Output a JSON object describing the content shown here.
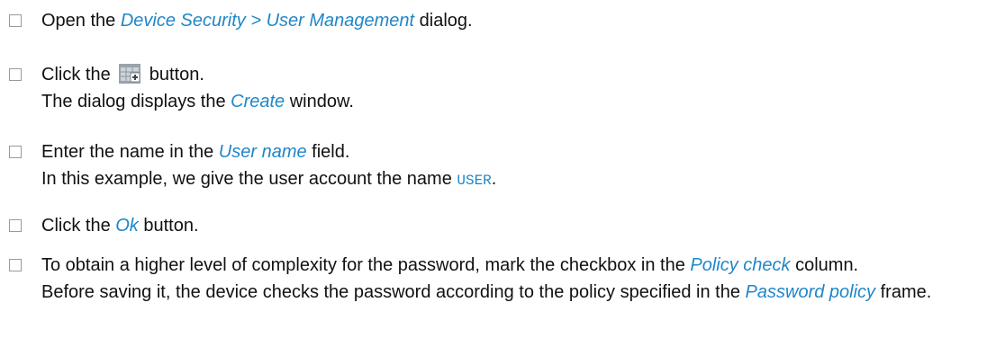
{
  "steps": [
    {
      "pre": "Open the ",
      "ref": "Device Security > User Management",
      "post": " dialog."
    },
    {
      "pre": "Click the ",
      "icon": "add-table-row-icon",
      "post": " button.",
      "result_pre": "The dialog displays the ",
      "result_ref": "Create",
      "result_post": " window."
    },
    {
      "pre": "Enter the name in the ",
      "ref": "User name",
      "post": " field.",
      "result_pre": "In this example, we give the user account the name ",
      "result_code": "USER",
      "result_post": "."
    },
    {
      "pre": "Click the ",
      "ref": "Ok",
      "post": " button."
    },
    {
      "pre": "To obtain a higher level of complexity for the password, mark the checkbox in the ",
      "ref": "Policy check",
      "post": " column.",
      "result_pre": "Before saving it, the device checks the password according to the policy specified in the ",
      "result_ref": "Password policy",
      "result_post": " frame."
    }
  ],
  "colors": {
    "reference": "#1f86c8",
    "text": "#111111",
    "checkbox_border": "#9a9a9a"
  }
}
